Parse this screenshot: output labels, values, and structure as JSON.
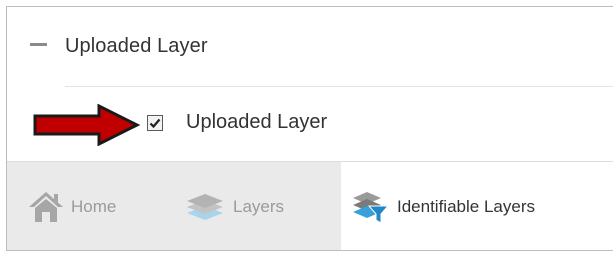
{
  "group": {
    "title": "Uploaded Layer",
    "collapse_icon": "minus-icon"
  },
  "layer": {
    "label": "Uploaded Layer",
    "checked": true,
    "annotation": "arrow-icon"
  },
  "tabs": [
    {
      "label": "Home",
      "icon": "home-icon",
      "active": false
    },
    {
      "label": "Layers",
      "icon": "layers-icon",
      "active": false
    },
    {
      "label": "Identifiable Layers",
      "icon": "identifiable-layers-icon",
      "active": true
    }
  ],
  "colors": {
    "arrow_fill": "#c00000",
    "arrow_outline": "#1a1a1a",
    "icon_gray": "#a6a6a6",
    "icon_blue": "#3aa0dc",
    "tab_bar": "#eaeaea"
  }
}
